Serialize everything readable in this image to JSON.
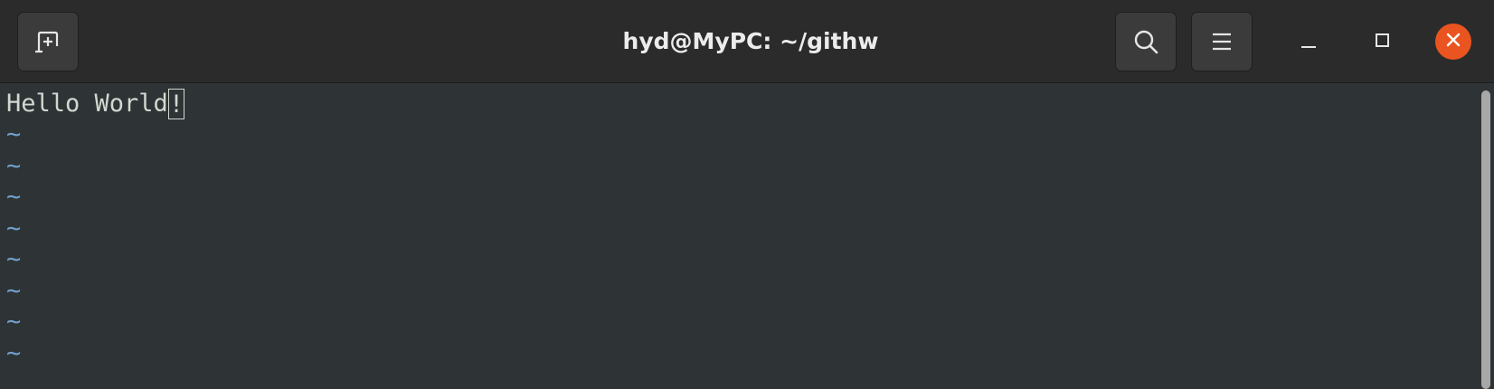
{
  "window": {
    "title": "hyd@MyPC: ~/githw"
  },
  "headerbar": {
    "new_tab_icon": "new-tab-icon",
    "search_icon": "search-icon",
    "menu_icon": "hamburger-menu-icon",
    "minimize_icon": "minimize-icon",
    "maximize_icon": "maximize-icon",
    "close_icon": "close-icon",
    "close_color": "#e95420"
  },
  "terminal": {
    "text_before_cursor": "Hello World",
    "cursor_char": "!",
    "tilde": "~",
    "empty_line_count": 8,
    "foreground": "#d3d7cf",
    "background": "#2e3436",
    "tilde_color": "#729fcf"
  }
}
